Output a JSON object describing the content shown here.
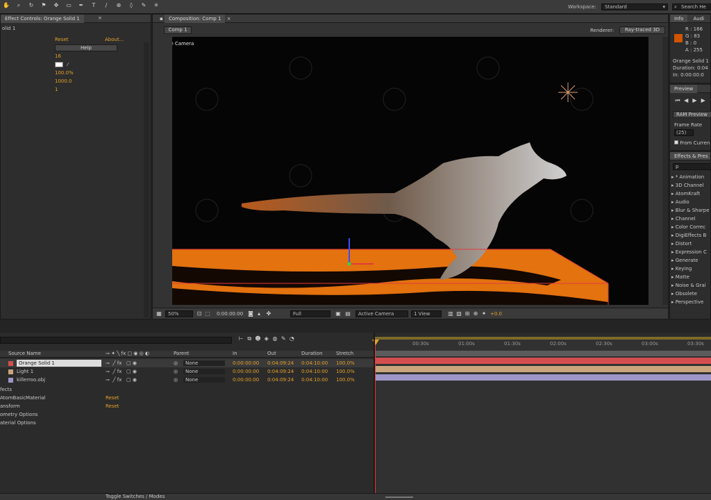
{
  "toolbar": {
    "workspace_label": "Workspace:",
    "workspace_value": "Standard",
    "search_label": "Search He",
    "tool_icons": [
      "hand-icon",
      "zoom-icon",
      "rotate-icon",
      "camera-icon",
      "pan-icon",
      "mask-icon",
      "pen-icon",
      "type-icon",
      "brush-icon",
      "clone-icon",
      "eraser-icon",
      "roto-icon",
      "puppet-icon"
    ]
  },
  "effect_controls": {
    "tab": "Effect Controls: Orange Solid 1",
    "layer": "olid 1",
    "reset": "Reset",
    "about": "About...",
    "help": "Help",
    "values": [
      "16",
      "100.0%",
      "1000.0",
      "1"
    ]
  },
  "composition": {
    "tab": "Composition: Comp 1",
    "comp_button": "Comp 1",
    "renderer_label": "Renderer:",
    "renderer_value": "Ray-traced 3D",
    "view_label": "Active Camera",
    "footer": {
      "zoom": "50%",
      "timecode": "0:00:00:00",
      "resolution": "Full",
      "camera": "Active Camera",
      "views": "1 View",
      "exposure": "+0.0"
    }
  },
  "info": {
    "tabs": [
      "Info",
      "Audi"
    ],
    "r": "R : 166",
    "g": "G : 83",
    "b": "B : 0",
    "a": "A : 255",
    "layer": "Orange Solid 1",
    "duration": "Duration: 0:04",
    "in": "In: 0:00:00:0",
    "swatch": "#d35400"
  },
  "preview": {
    "tab": "Preview",
    "ram_preview": "RAM Preview",
    "frame_rate_label": "Frame Rate",
    "frame_rate_value": "(25)",
    "from_current": "From Curren"
  },
  "effects_presets": {
    "tab": "Effects & Pres",
    "search_placeholder": "p",
    "items": [
      "* Animation",
      "3D Channel",
      "AtomKraft",
      "Audio",
      "Blur & Sharpe",
      "Channel",
      "Color Correc",
      "DigiEffects B",
      "Distort",
      "Expression C",
      "Generate",
      "Keying",
      "Matte",
      "Noise & Grai",
      "Obsolete",
      "Perspective"
    ]
  },
  "timeline": {
    "columns": {
      "source_name": "Source Name",
      "parent": "Parent",
      "in": "In",
      "out": "Out",
      "duration": "Duration",
      "stretch": "Stretch"
    },
    "layers": [
      {
        "name": "Orange Solid 1",
        "parent": "None",
        "in": "0:00:00:00",
        "out": "0:04:09:24",
        "duration": "0:04:10:00",
        "stretch": "100.0%",
        "color": "#d34f4f"
      },
      {
        "name": "Light 1",
        "parent": "None",
        "in": "0:00:00:00",
        "out": "0:04:09:24",
        "duration": "0:04:10:00",
        "stretch": "100.0%",
        "color": "#c8a57c"
      },
      {
        "name": "killerroo.obj",
        "parent": "None",
        "in": "0:00:00:00",
        "out": "0:04:09:24",
        "duration": "0:04:10:00",
        "stretch": "100.0%",
        "color": "#9e95c8"
      }
    ],
    "sub_rows": [
      {
        "label": "fects",
        "value": ""
      },
      {
        "label": "AtomBasicMaterial",
        "value": "Reset"
      },
      {
        "label": "ansform",
        "value": "Reset"
      },
      {
        "label": "ometry Options",
        "value": ""
      },
      {
        "label": "aterial Options",
        "value": ""
      }
    ],
    "ruler": [
      "00:30s",
      "01:00s",
      "01:30s",
      "02:00s",
      "02:30s",
      "03:00s",
      "03:30s"
    ],
    "toggle_label": "Toggle Switches / Modes"
  },
  "colors": {
    "accent": "#e6a12a",
    "panel_bg": "#2d2d2d",
    "floor": "#e3720f",
    "gizmo": "#e23a3a"
  }
}
